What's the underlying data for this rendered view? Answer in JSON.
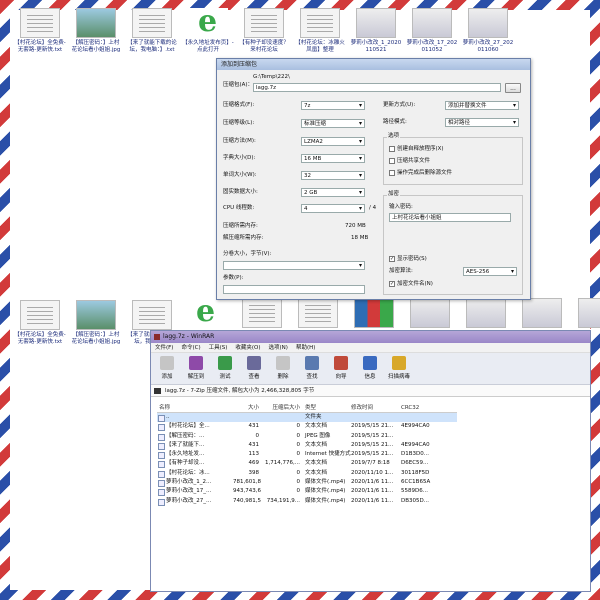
{
  "desktop_top": [
    {
      "label": "【村花论坛】全免费-无套路-更新快.txt",
      "kind": "txt"
    },
    {
      "label": "【解压密码：】上村花论坛看小姐姐.jpg",
      "kind": "img"
    },
    {
      "label": "【来了就能下载的论坛，我电脑：】.txt",
      "kind": "txt"
    },
    {
      "label": "【永久地址发布页】-点此打开",
      "kind": "ie"
    },
    {
      "label": "【有种子却没速度？来村花论坛",
      "kind": "txt"
    },
    {
      "label": "【村花论坛：冰雕火凤凰】整理",
      "kind": "txt"
    },
    {
      "label": "萝莉小改改_1_2020110521",
      "kind": "vid"
    },
    {
      "label": "萝莉小改改_17_202011052",
      "kind": "vid"
    },
    {
      "label": "萝莉小改改_27_202011060",
      "kind": "vid"
    }
  ],
  "desktop_bottom": [
    {
      "label": "【村花论坛】全免费-无套路-更新快.txt",
      "kind": "txt"
    },
    {
      "label": "【解压密码：】上村花论坛看小姐姐.jpg",
      "kind": "img"
    },
    {
      "label": "【来了就能下载的论坛，我电脑：】",
      "kind": "txt"
    }
  ],
  "desktop_bottom_right": [
    "",
    "",
    "",
    "",
    "",
    "",
    "",
    ""
  ],
  "dialog": {
    "title": "添加到压缩包",
    "archive_label": "压缩包(A)：",
    "archive_dir": "G:\\Temp\\222\\",
    "archive_name": "lagg.7z",
    "browse": "...",
    "format_label": "压缩格式(F):",
    "format": "7z",
    "level_label": "压缩等级(L):",
    "level": "标准压缩",
    "method_label": "压缩方法(M):",
    "method": "LZMA2",
    "dict_label": "字典大小(D):",
    "dict": "16 MB",
    "word_label": "单词大小(W):",
    "word": "32",
    "solid_label": "固实数据大小:",
    "solid": "2 GB",
    "cpu_label": "CPU 线程数:",
    "cpu": "4",
    "cpu_total": "/ 4",
    "mem_c_label": "压缩所需内存:",
    "mem_c": "720 MB",
    "mem_d_label": "解压缩所需内存:",
    "mem_d": "18 MB",
    "split_label": "分卷大小，字节(V):",
    "params_label": "参数(P):",
    "update_label": "更新方式(U):",
    "update": "添加并替换文件",
    "path_label": "路径模式:",
    "path": "相对路径",
    "options_title": "选项",
    "opt1": "创建自释放程序(X)",
    "opt2": "压缩共享文件",
    "opt3": "操作完成后删除源文件",
    "enc_title": "加密",
    "pwd_label": "输入密码:",
    "pwd": "上村花论坛看小姐姐",
    "show_pwd": "显示密码(S)",
    "enc_method_label": "加密算法:",
    "enc_method": "AES-256",
    "enc_names": "加密文件名(N)"
  },
  "winrar": {
    "title": "lagg.7z - WinRAR",
    "menu": [
      "文件(F)",
      "命令(C)",
      "工具(S)",
      "收藏夹(O)",
      "选项(N)",
      "帮助(H)"
    ],
    "tools": [
      {
        "label": "添加",
        "color": "#c5c5c5"
      },
      {
        "label": "解压到",
        "color": "#8e4aa8"
      },
      {
        "label": "测试",
        "color": "#3a9a4a"
      },
      {
        "label": "查看",
        "color": "#6a6a9a"
      },
      {
        "label": "删除",
        "color": "#c5c5c5"
      },
      {
        "label": "查找",
        "color": "#5a7ab0"
      },
      {
        "label": "向导",
        "color": "#c04a3a"
      },
      {
        "label": "信息",
        "color": "#3a6ac0"
      },
      {
        "label": "扫描病毒",
        "color": "#d8a82a"
      }
    ],
    "path": "lagg.7z - 7-Zip 压缩文件, 解包大小为 2,466,328,805 字节",
    "columns": [
      "名称",
      "大小",
      "压缩后大小",
      "类型",
      "修改时间",
      "CRC32"
    ],
    "rows": [
      {
        "name": "..",
        "size": "",
        "packed": "",
        "type": "文件夹",
        "modified": "",
        "crc": ""
      },
      {
        "name": "【村花论坛】全...",
        "size": "431",
        "packed": "0",
        "type": "文本文档",
        "modified": "2019/5/15 21...",
        "crc": "4E994CA0"
      },
      {
        "name": "【解压密码：...",
        "size": "0",
        "packed": "0",
        "type": "JPEG 图像",
        "modified": "2019/5/15 21...",
        "crc": ""
      },
      {
        "name": "【来了就能下...",
        "size": "431",
        "packed": "0",
        "type": "文本文档",
        "modified": "2019/5/15 21...",
        "crc": "4E994CA0"
      },
      {
        "name": "【永久地址发...",
        "size": "113",
        "packed": "0",
        "type": "Internet 快捷方式",
        "modified": "2019/5/15 21...",
        "crc": "D1B3D0..."
      },
      {
        "name": "【有种子却没...",
        "size": "469",
        "packed": "1,714,776,...",
        "type": "文本文档",
        "modified": "2019/7/7 8:18",
        "crc": "D6EC59..."
      },
      {
        "name": "【村花论坛：冰...",
        "size": "398",
        "packed": "0",
        "type": "文本文档",
        "modified": "2020/11/10 1...",
        "crc": "30118F5D"
      },
      {
        "name": "萝莉小改改_1_2...",
        "size": "781,601,8...",
        "packed": "0",
        "type": "媒体文件(.mp4)",
        "modified": "2020/11/6 11...",
        "crc": "6CC1B65A"
      },
      {
        "name": "萝莉小改改_17_...",
        "size": "943,743,6...",
        "packed": "0",
        "type": "媒体文件(.mp4)",
        "modified": "2020/11/6 11...",
        "crc": "5589D6..."
      },
      {
        "name": "萝莉小改改_27_...",
        "size": "740,981,5...",
        "packed": "734,191,9...",
        "type": "媒体文件(.mp4)",
        "modified": "2020/11/6 11...",
        "crc": "DB305D..."
      }
    ]
  }
}
